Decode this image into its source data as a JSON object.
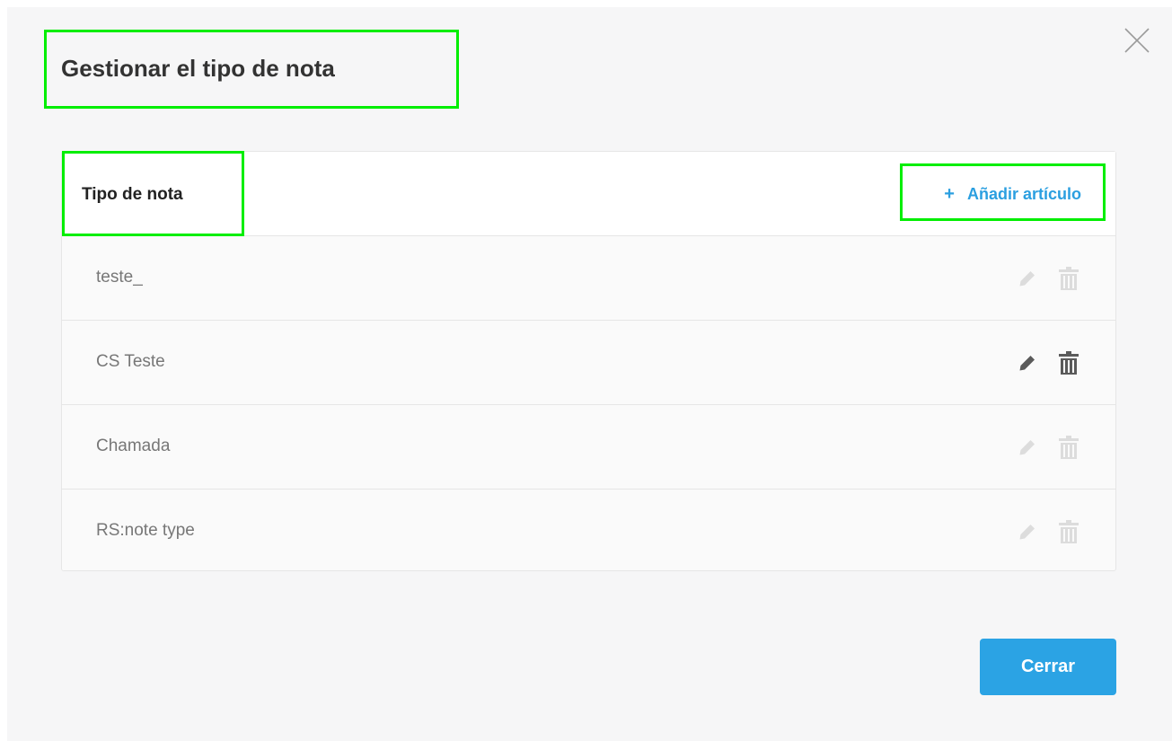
{
  "dialog": {
    "title": "Gestionar el tipo de nota",
    "close_icon": "close-icon"
  },
  "panel": {
    "header_label": "Tipo de nota",
    "add_plus": "+",
    "add_label": "Añadir artículo",
    "items": [
      {
        "label": "teste_",
        "state": "disabled"
      },
      {
        "label": "CS Teste",
        "state": "active"
      },
      {
        "label": "Chamada",
        "state": "disabled"
      },
      {
        "label": "RS:note type",
        "state": "disabled"
      }
    ],
    "item_icons": [
      "pencil-icon",
      "trash-icon"
    ]
  },
  "footer": {
    "close_label": "Cerrar"
  },
  "colors": {
    "accent": "#2ba3e4",
    "highlight": "#00ee00",
    "icon_active": "#5a5a5a",
    "icon_disabled": "#dcdcdc"
  }
}
